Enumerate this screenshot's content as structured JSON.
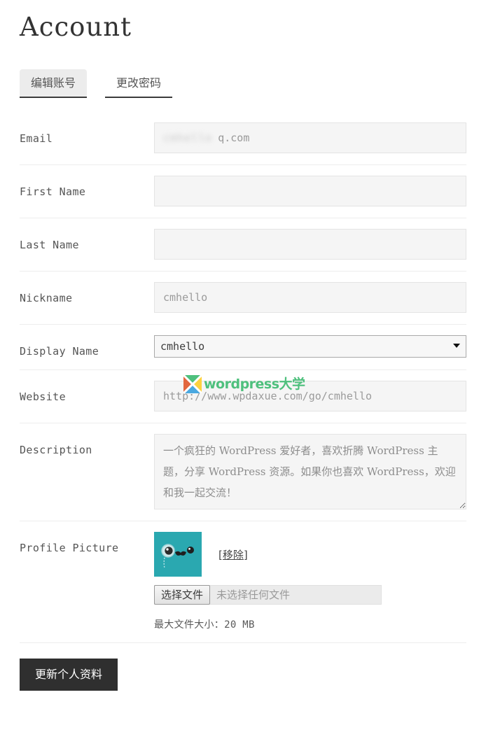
{
  "page": {
    "title": "Account"
  },
  "tabs": [
    {
      "label": "编辑账号",
      "active": true
    },
    {
      "label": "更改密码",
      "active": false
    }
  ],
  "fields": {
    "email": {
      "label": "Email",
      "redacted_value": "cmhello",
      "visible_value": "q.com",
      "placeholder": ""
    },
    "first_name": {
      "label": "First Name",
      "value": "",
      "placeholder": ""
    },
    "last_name": {
      "label": "Last Name",
      "value": "",
      "placeholder": ""
    },
    "nickname": {
      "label": "Nickname",
      "value": "cmhello",
      "placeholder": "cmhello"
    },
    "display_name": {
      "label": "Display Name",
      "value": "cmhello",
      "options": [
        "cmhello"
      ]
    },
    "website": {
      "label": "Website",
      "value": "http://www.wpdaxue.com/go/cmhello",
      "placeholder": "http://www.wpdaxue.com/go/cmhello"
    },
    "description": {
      "label": "Description",
      "value": "一个疯狂的 WordPress 爱好者，喜欢折腾 WordPress 主题，分享 WordPress 资源。如果你也喜欢 WordPress，欢迎和我一起交流！"
    },
    "profile_picture": {
      "label": "Profile Picture",
      "remove_label": "[移除]",
      "file_button_label": "选择文件",
      "file_name_text": "未选择任何文件",
      "max_size_text": "最大文件大小：20 MB"
    }
  },
  "submit": {
    "label": "更新个人资料"
  },
  "watermark": {
    "text": "wordpress大学"
  },
  "colors": {
    "submit_bg": "#2f2f2f",
    "active_tab_bg": "#ececec",
    "input_bg": "#f5f5f5",
    "avatar_bg": "#2aa8b0",
    "watermark_green": "#4ec07d"
  }
}
